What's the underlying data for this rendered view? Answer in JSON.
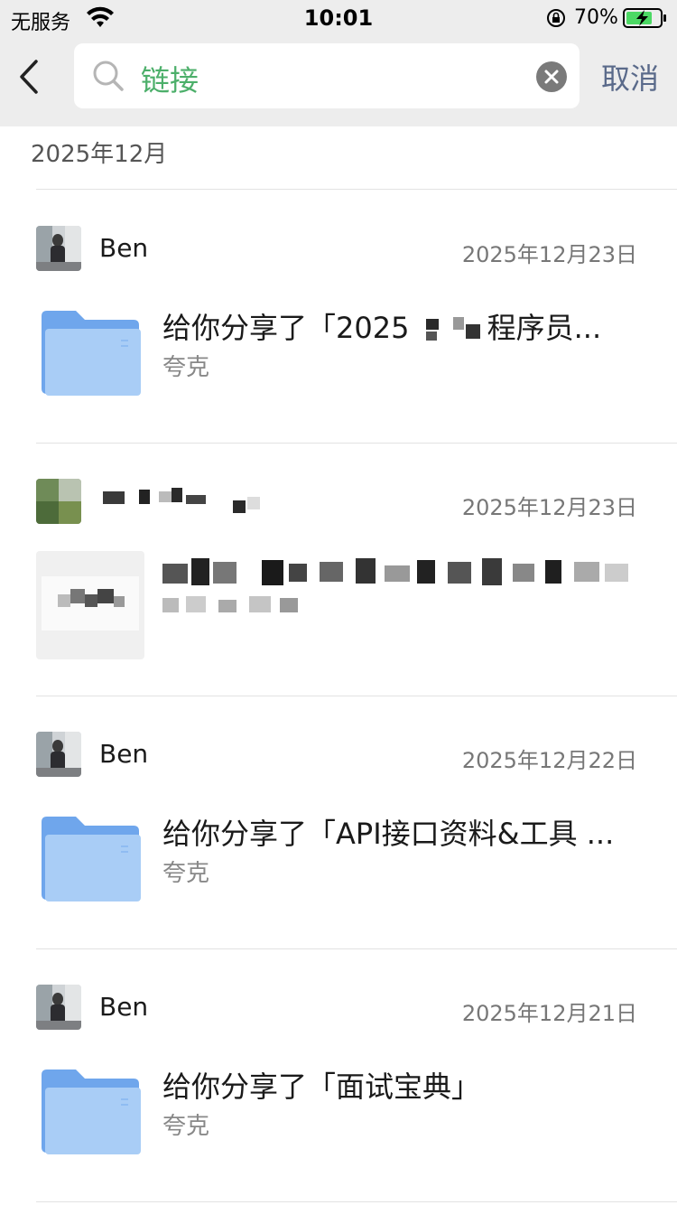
{
  "status_bar": {
    "carrier": "无服务",
    "time": "10:01",
    "battery_percent": "70%"
  },
  "nav": {
    "back_icon": "chevron-left-icon",
    "search_value": "链接",
    "cancel_label": "取消"
  },
  "section": {
    "title": "2025年12月"
  },
  "colors": {
    "accent_green": "#4caf6a",
    "cancel_blue": "#5a6a8a",
    "folder_blue": "#7fb2ef"
  },
  "results": [
    {
      "sender": "Ben",
      "date": "2025年12月23日",
      "title_prefix": "给你分享了「2025",
      "title_suffix": "程序员...",
      "source": "夸克",
      "thumb_icon": "folder-icon"
    },
    {
      "sender": "",
      "date": "2025年12月23日",
      "title_prefix": "",
      "title_suffix": "",
      "source": "",
      "thumb_icon": "link-preview-thumbnail"
    },
    {
      "sender": "Ben",
      "date": "2025年12月22日",
      "title_prefix": "给你分享了「API接口资料&工具 ...",
      "title_suffix": "",
      "source": "夸克",
      "thumb_icon": "folder-icon"
    },
    {
      "sender": "Ben",
      "date": "2025年12月21日",
      "title_prefix": "给你分享了「面试宝典」",
      "title_suffix": "",
      "source": "夸克",
      "thumb_icon": "folder-icon"
    }
  ]
}
